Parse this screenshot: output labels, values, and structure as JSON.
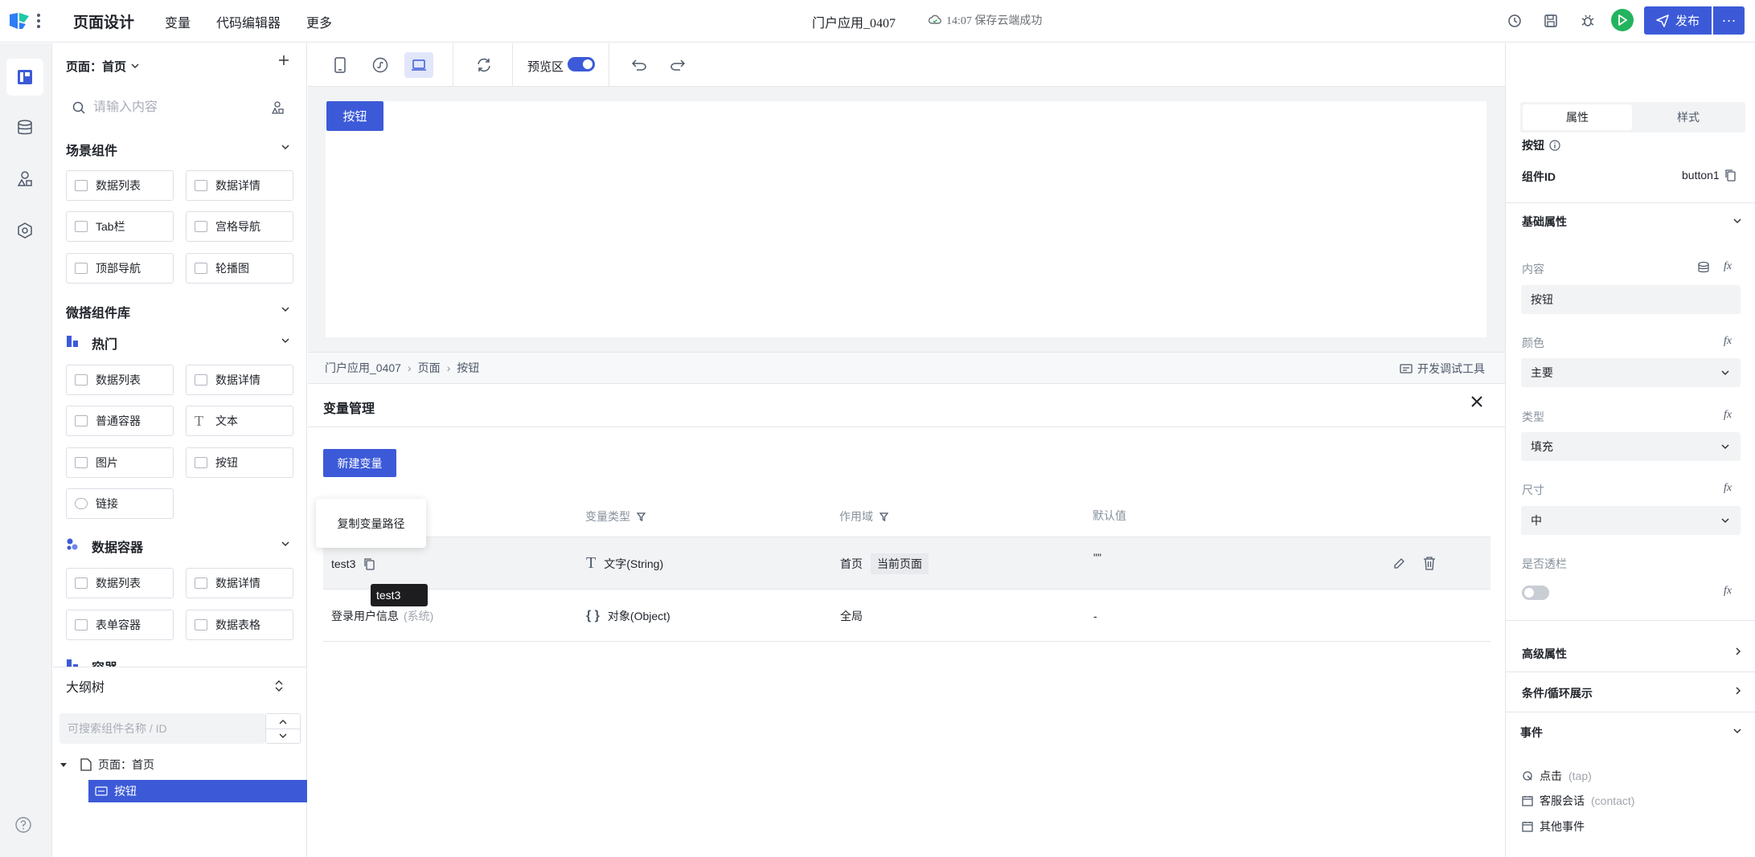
{
  "topbar": {
    "app_title": "页面设计",
    "nav": [
      "变量",
      "代码编辑器",
      "更多"
    ],
    "project_name": "门户应用_0407",
    "save_status": "14:07 保存云端成功",
    "publish_label": "发布",
    "more_label": "···",
    "icons": [
      "history-icon",
      "save-icon",
      "debug-icon",
      "run-icon"
    ],
    "accent_color": "#3c5ad8"
  },
  "rail": {
    "items": [
      "page-layout-icon",
      "database-icon",
      "components-icon",
      "settings-icon"
    ]
  },
  "component_panel": {
    "page_selector": "页面：首页",
    "search_placeholder": "请输入内容",
    "sections": {
      "scene": {
        "title": "场景组件",
        "items": [
          "数据列表",
          "数据详情",
          "Tab栏",
          "宫格导航",
          "顶部导航",
          "轮播图"
        ]
      },
      "library": {
        "title": "微搭组件库"
      },
      "hot": {
        "title": "热门",
        "items": [
          "数据列表",
          "数据详情",
          "普通容器",
          "文本",
          "图片",
          "按钮",
          "链接"
        ]
      },
      "data_container": {
        "title": "数据容器",
        "items": [
          "数据列表",
          "数据详情",
          "表单容器",
          "数据表格"
        ]
      },
      "partial": {
        "title": "容器"
      }
    }
  },
  "outline": {
    "title": "大纲树",
    "search_placeholder": "可搜索组件名称 / ID",
    "root": "页面：首页",
    "selected": "按钮"
  },
  "toolbar": {
    "preview_label": "预览区",
    "preview_on": true
  },
  "canvas": {
    "button_label": "按钮"
  },
  "breadcrumb": {
    "items": [
      "门户应用_0407",
      "页面",
      "按钮"
    ],
    "devtools": "开发调试工具"
  },
  "var_manager": {
    "title": "变量管理",
    "new_button": "新建变量",
    "columns": {
      "type": "变量类型",
      "scope": "作用域",
      "default": "默认值"
    },
    "rows": [
      {
        "name": "test3",
        "type": "文字(String)",
        "type_icon": "T",
        "scope": "首页",
        "scope_tag": "当前页面",
        "default": "\"\""
      },
      {
        "name": "登录用户信息",
        "sys": "(系统)",
        "type": "对象(Object)",
        "type_icon": "{ }",
        "scope": "全局",
        "default": "-"
      }
    ],
    "popover": "复制变量路径",
    "tooltip": "test3"
  },
  "props": {
    "tabs": [
      "属性",
      "样式"
    ],
    "component_name": "按钮",
    "id_label": "组件ID",
    "id_value": "button1",
    "basic_section": "基础属性",
    "content_label": "内容",
    "content_value": "按钮",
    "color_label": "颜色",
    "color_value": "主要",
    "type_label": "类型",
    "type_value": "填充",
    "size_label": "尺寸",
    "size_value": "中",
    "transparent_label": "是否透栏",
    "fx": "fx",
    "advanced_section": "高级属性",
    "condition_section": "条件/循环展示",
    "events_section": "事件",
    "events": [
      {
        "name": "点击",
        "sub": "(tap)"
      },
      {
        "name": "客服会话",
        "sub": "(contact)"
      },
      {
        "name": "其他事件",
        "sub": ""
      }
    ]
  }
}
